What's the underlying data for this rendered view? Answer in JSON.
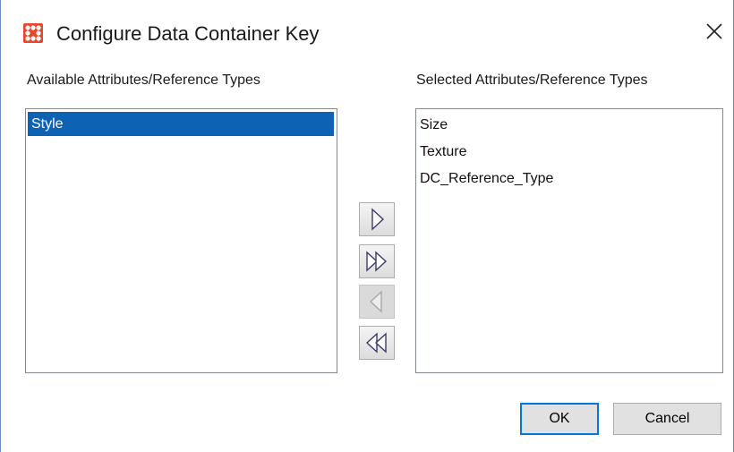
{
  "window": {
    "title": "Configure Data Container Key",
    "accent_color": "#e8472b"
  },
  "available": {
    "label": "Available Attributes/Reference Types",
    "items": [
      "Style"
    ],
    "selected_index": 0
  },
  "selected": {
    "label": "Selected Attributes/Reference Types",
    "items": [
      "Size",
      "Texture",
      "DC_Reference_Type"
    ]
  },
  "movers": [
    {
      "icon": "add-right-icon",
      "enabled": true
    },
    {
      "icon": "add-all-right-icon",
      "enabled": true
    },
    {
      "icon": "remove-left-icon",
      "enabled": false
    },
    {
      "icon": "remove-all-left-icon",
      "enabled": true
    }
  ],
  "buttons": {
    "ok": "OK",
    "cancel": "Cancel"
  }
}
